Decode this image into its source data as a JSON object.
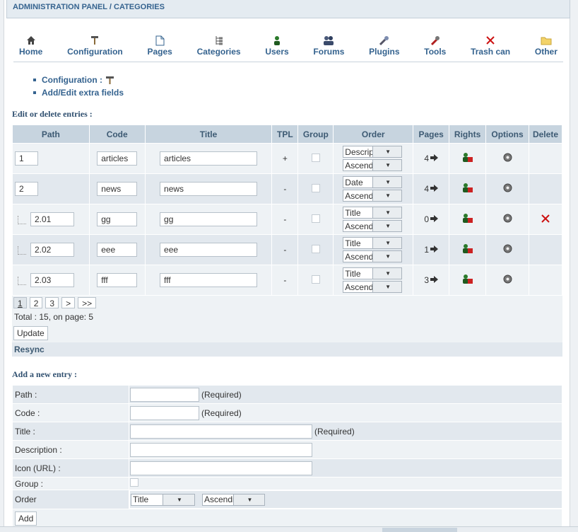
{
  "header": {
    "title": "ADMINISTRATION PANEL / CATEGORIES"
  },
  "toolbar": [
    {
      "label": "Home",
      "icon": "home-icon"
    },
    {
      "label": "Configuration",
      "icon": "hammer-icon"
    },
    {
      "label": "Pages",
      "icon": "page-icon"
    },
    {
      "label": "Categories",
      "icon": "tree-icon"
    },
    {
      "label": "Users",
      "icon": "user-icon"
    },
    {
      "label": "Forums",
      "icon": "users-icon"
    },
    {
      "label": "Plugins",
      "icon": "plugin-icon"
    },
    {
      "label": "Tools",
      "icon": "tools-icon"
    },
    {
      "label": "Trash can",
      "icon": "x-icon"
    },
    {
      "label": "Other",
      "icon": "folder-icon"
    }
  ],
  "sublinks": {
    "configuration": "Configuration :",
    "extra_fields": "Add/Edit extra fields"
  },
  "edit_title": "Edit or delete entries :",
  "columns": [
    "Path",
    "Code",
    "Title",
    "TPL",
    "Group",
    "Order",
    "Pages",
    "Rights",
    "Options",
    "Delete"
  ],
  "rows": [
    {
      "path": "1",
      "code": "articles",
      "title": "articles",
      "tpl": "+",
      "order_by": "Description",
      "order_dir": "Ascending",
      "pages": "4",
      "child": false,
      "delete": false
    },
    {
      "path": "2",
      "code": "news",
      "title": "news",
      "tpl": "-",
      "order_by": "Date",
      "order_dir": "Ascending",
      "pages": "4",
      "child": false,
      "delete": false
    },
    {
      "path": "2.01",
      "code": "gg",
      "title": "gg",
      "tpl": "-",
      "order_by": "Title",
      "order_dir": "Ascending",
      "pages": "0",
      "child": true,
      "delete": true
    },
    {
      "path": "2.02",
      "code": "eee",
      "title": "eee",
      "tpl": "-",
      "order_by": "Title",
      "order_dir": "Ascending",
      "pages": "1",
      "child": true,
      "delete": false
    },
    {
      "path": "2.03",
      "code": "fff",
      "title": "fff",
      "tpl": "-",
      "order_by": "Title",
      "order_dir": "Ascending",
      "pages": "3",
      "child": true,
      "delete": false
    }
  ],
  "pager": {
    "pages": [
      "1",
      "2",
      "3"
    ],
    "current": "1",
    "next": ">",
    "last": ">>"
  },
  "total_text": "Total : 15, on page: 5",
  "update_label": "Update",
  "resync_label": "Resync",
  "add_title": "Add a new entry :",
  "form": {
    "path_label": "Path :",
    "code_label": "Code :",
    "title_label": "Title :",
    "description_label": "Description :",
    "icon_label": "Icon (URL) :",
    "group_label": "Group :",
    "order_label": "Order",
    "required": "(Required)",
    "order_by": "Title",
    "order_dir": "Ascending",
    "add_label": "Add"
  },
  "colors": {
    "accent": "#35638f",
    "header_bg": "#c7d4df",
    "delete": "#cc1111"
  }
}
